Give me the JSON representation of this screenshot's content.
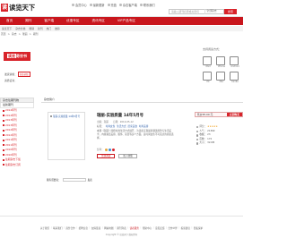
{
  "brand": {
    "logo_mark": "读",
    "logo_text": "读览天下"
  },
  "toplinks": [
    "会员中心",
    "最新更新",
    "充值",
    "杂志客户端",
    "联系我们"
  ],
  "search": {
    "placeholder": "请输入期刊名称或关键词",
    "scope": "全部杂志",
    "button": "搜索"
  },
  "nav": [
    "首页",
    "期刊",
    "客户端",
    "优惠专区",
    "资讯专区",
    "VIP产品专区"
  ],
  "subnav": [
    "读览天下",
    "杂志分类",
    "畅销",
    "新刊",
    "热门",
    "推荐"
  ],
  "breadcrumb": [
    "首页",
    "杂志",
    "瑞丽",
    "期刊"
  ],
  "store": {
    "badge_a": "读览",
    "badge_b": "奇农书",
    "qualification_label": "发货资格：",
    "license_tag": "营业执照",
    "qualification_label2": "资质证书：",
    "device_title": "支持阅读方式："
  },
  "devices": [
    "iPad",
    "iPhone",
    "Android",
    "PC",
    "Mac",
    "Kindle"
  ],
  "sidebar": {
    "head": "杂志往期刊物",
    "sub": "最新期刊",
    "items": [
      "2014年刊",
      "2014年刊",
      "2013年刊",
      "2013年刊",
      "2012年刊",
      "2012年刊",
      "2011年刊",
      "2011年刊",
      "2010年刊",
      "2010年刊",
      "往期杂志下载",
      "往期杂志订阅"
    ]
  },
  "main": {
    "tab": "杂志简介",
    "product_alt": "瑞丽-实验质量 14年5月号",
    "title": "瑞丽-实验质量 14年5月号",
    "meta_author": "出版：瑞丽",
    "meta_date": "日期：2014-05-12",
    "meta_tags_label": "标签：",
    "meta_tags": [
      "时尚女性",
      "生活方式",
      "居家美食",
      "时尚美容"
    ],
    "description": "本期《瑞丽》围绕时尚生活方式展开，为读者呈现最新潮流趋势与生活美学，内容涵盖美容、服饰、家居等多个方面，是时尚女性不可错过的阅读选择。",
    "share_label": "分享：",
    "buttons": [
      "立即阅读",
      "加入收藏"
    ]
  },
  "price": {
    "label": "售价¥5.00 元",
    "buy": "立即购买",
    "stats": [
      {
        "label": "评分：",
        "value": "★★★★★"
      },
      {
        "label": "人气：",
        "value": "21369"
      },
      {
        "label": "收藏：",
        "value": "23"
      },
      {
        "label": "页数：",
        "value": "172"
      },
      {
        "label": "大小：",
        "value": "32.6M"
      }
    ]
  },
  "review": {
    "label": "我有话要说：",
    "button": "发表"
  },
  "footer": {
    "links": [
      "关于我们",
      "联系我们",
      "商务合作",
      "招聘信息",
      "友情链接",
      "网站地图",
      "期刊列表",
      "读者服务",
      "帮助中心",
      "意见反馈",
      "合作伙伴",
      "投诉建议",
      "隐私保护"
    ],
    "highlight_index": 7,
    "copyright": "Copyright © 读览天下 版权所有"
  },
  "colors": {
    "brand_red": "#d8232a",
    "nav_red": "#c9161d",
    "link_blue": "#2a5ca8"
  }
}
